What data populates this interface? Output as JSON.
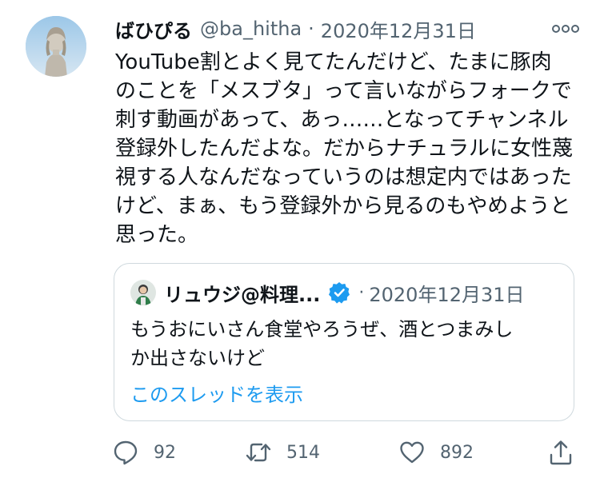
{
  "tweet": {
    "display_name": "ばひぴる",
    "handle": "@ba_hitha",
    "separator": "·",
    "date": "2020年12月31日",
    "text_lines": [
      "YouTube割とよく見てたんだけど、たまに豚肉",
      "のことを「メスブタ」って言いながらフォークで",
      "刺す動画があって、あっ……となってチャンネル",
      "登録外したんだよな。だからナチュラルに女性蔑",
      "視する人なんだなっていうのは想定内ではあった",
      "けど、まぁ、もう登録外から見るのもやめようと",
      "思った。"
    ]
  },
  "quote": {
    "display_name": "リュウジ@料理...",
    "separator": "·",
    "date": "2020年12月31日",
    "text_lines": [
      "もうおにいさん食堂やろうぜ、酒とつまみし",
      "か出さないけど"
    ],
    "thread_link": "このスレッドを表示"
  },
  "actions": {
    "reply_count": "92",
    "retweet_count": "514",
    "like_count": "892"
  },
  "colors": {
    "text": "#0f1419",
    "secondary": "#536471",
    "accent": "#1d9bf0",
    "border": "#cfd9de"
  },
  "icons": [
    "more-icon",
    "verified-icon",
    "reply-icon",
    "retweet-icon",
    "like-icon",
    "share-icon"
  ]
}
